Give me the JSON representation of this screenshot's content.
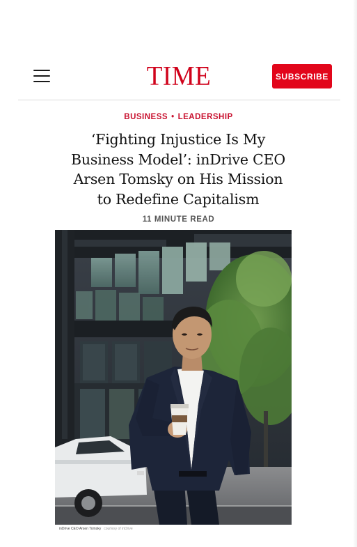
{
  "header": {
    "logo_text": "TIME",
    "subscribe_label": "SUBSCRIBE",
    "menu_icon": "hamburger-menu-icon"
  },
  "article": {
    "kicker": {
      "section": "BUSINESS",
      "separator": "•",
      "subsection": "LEADERSHIP"
    },
    "headline_lines": [
      "‘Fighting Injustice Is My",
      "Business Model’: inDrive CEO",
      "Arsen Tomsky on His Mission",
      "to Redefine Capitalism"
    ],
    "read_time": "11 MINUTE READ",
    "image": {
      "caption": "inDrive CEO Arsen Tomsky",
      "credit": "courtesy of inDrive"
    }
  },
  "colors": {
    "brand_red": "#e2061b",
    "logo_red": "#d0021b",
    "kicker_red": "#c8102e",
    "headline": "#111111",
    "readtime": "#555555"
  }
}
